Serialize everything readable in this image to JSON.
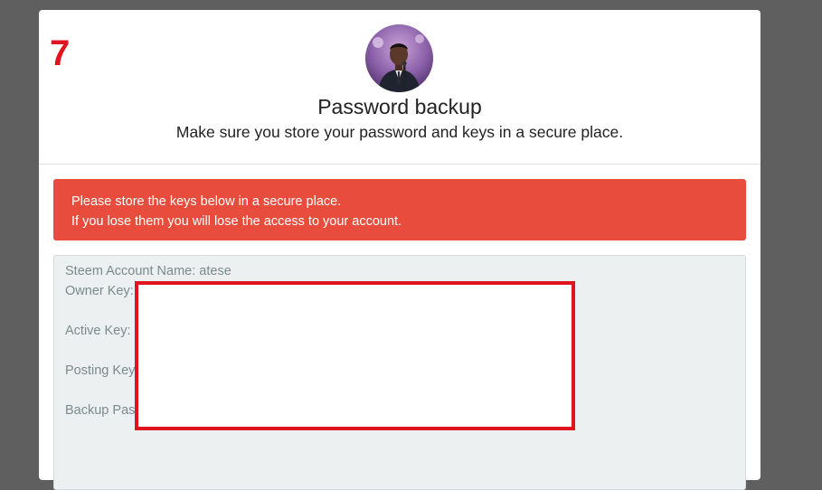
{
  "step": {
    "number": "7",
    "color": "#e0141e"
  },
  "header": {
    "avatar": "avatar-photo",
    "title": "Password backup",
    "subtitle": "Make sure you store your password and keys in a secure place."
  },
  "alert": {
    "line1": "Please store the keys below in a secure place.",
    "line2": "If you lose them you will lose the access to your account.",
    "color": "#e74c3c"
  },
  "keys": {
    "account_name": "Steem Account Name: atese",
    "owner_label": "Owner Key:",
    "active_label": "Active Key:",
    "posting_label": "Posting Key:",
    "backup_label": "Backup Password:"
  },
  "redaction": {
    "border_color": "#e0141e"
  }
}
